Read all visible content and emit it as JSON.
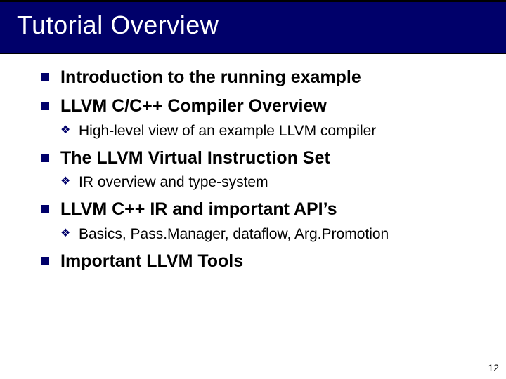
{
  "title": "Tutorial Overview",
  "items": [
    {
      "label": "Introduction to the running example",
      "sub": []
    },
    {
      "label": "LLVM C/C++ Compiler Overview",
      "sub": [
        {
          "label": "High-level view of an example LLVM compiler"
        }
      ]
    },
    {
      "label": "The LLVM Virtual Instruction Set",
      "sub": [
        {
          "label": "IR overview and type-system"
        }
      ]
    },
    {
      "label": "LLVM C++ IR and important API’s",
      "sub": [
        {
          "label": "Basics, Pass.Manager, dataflow, Arg.Promotion"
        }
      ]
    },
    {
      "label": "Important LLVM Tools",
      "sub": []
    }
  ],
  "page_number": "12"
}
